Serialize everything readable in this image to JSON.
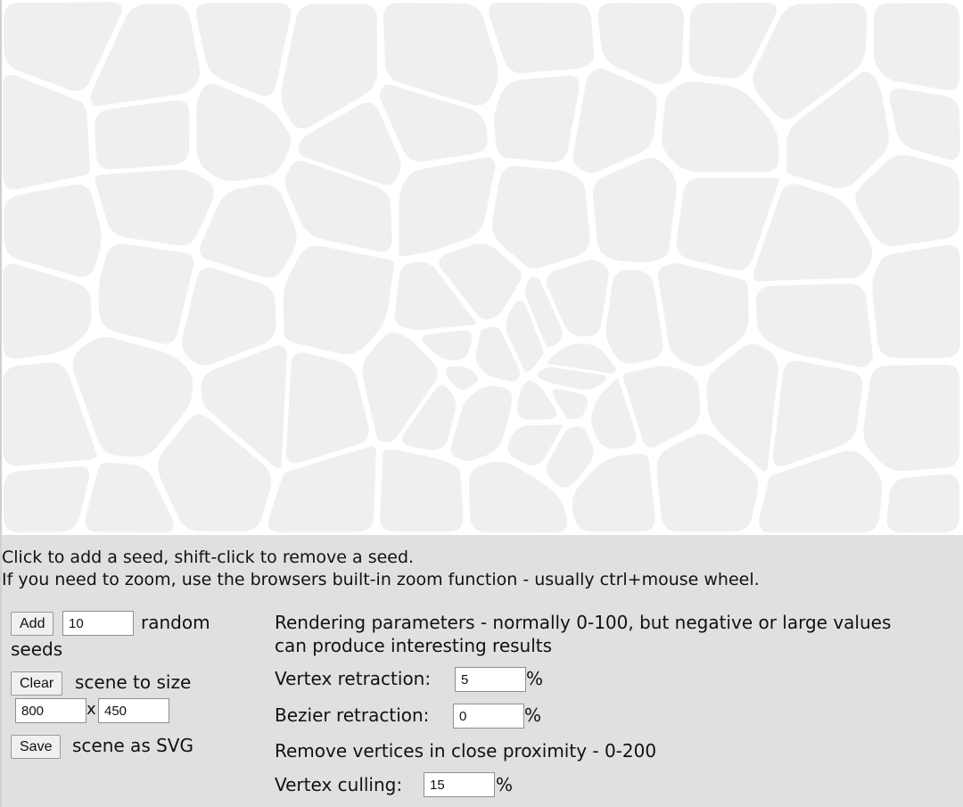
{
  "instructions": {
    "line1": "Click to add a seed, shift-click to remove a seed.",
    "line2": "If you need to zoom, use the browsers built-in zoom function - usually ctrl+mouse wheel."
  },
  "controls": {
    "add_label": "Add",
    "random_count": "10",
    "random_label_a": "random",
    "random_label_b": "seeds",
    "clear_label": "Clear",
    "scene_to_size": "scene to size",
    "width": "800",
    "times": "x",
    "height": "450",
    "save_label": "Save",
    "save_suffix": "scene as SVG"
  },
  "rendering": {
    "heading_line1": "Rendering parameters - normally 0-100, but negative or large values",
    "heading_line2": "can produce interesting results",
    "vertex_retraction_label": "Vertex retraction:",
    "vertex_retraction_value": "5",
    "bezier_retraction_label": "Bezier retraction:",
    "bezier_retraction_value": "0",
    "proximity_heading": "Remove vertices in close proximity - 0-200",
    "vertex_culling_label": "Vertex culling:",
    "vertex_culling_value": "15",
    "percent": "%"
  },
  "colors": {
    "canvas_bg": "#ffffff",
    "cell_fill": "#efefef",
    "panel_bg": "#e0e0e0"
  }
}
